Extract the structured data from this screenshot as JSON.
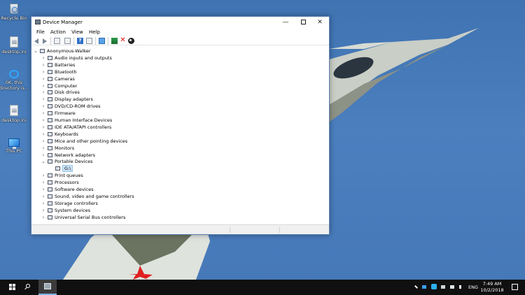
{
  "desktop": {
    "icons": [
      {
        "label": "Recycle Bin",
        "icon": "recycle-bin-icon"
      },
      {
        "label": "desktop.ini",
        "icon": "file-icon"
      },
      {
        "label": "0K, this directory is...",
        "icon": "onedrive-icon"
      },
      {
        "label": "desktop.ini",
        "icon": "file-icon"
      },
      {
        "label": "This PC",
        "icon": "this-pc-icon"
      }
    ]
  },
  "window": {
    "title": "Device Manager",
    "menu": [
      "File",
      "Action",
      "View",
      "Help"
    ],
    "controls": {
      "minimize": "—",
      "close": "✕"
    },
    "tree": {
      "root": "Anonymous-Walker",
      "categories": [
        {
          "label": "Audio inputs and outputs",
          "expanded": false
        },
        {
          "label": "Batteries",
          "expanded": false
        },
        {
          "label": "Bluetooth",
          "expanded": false
        },
        {
          "label": "Cameras",
          "expanded": false
        },
        {
          "label": "Computer",
          "expanded": false
        },
        {
          "label": "Disk drives",
          "expanded": false
        },
        {
          "label": "Display adapters",
          "expanded": false
        },
        {
          "label": "DVD/CD-ROM drives",
          "expanded": false
        },
        {
          "label": "Firmware",
          "expanded": false
        },
        {
          "label": "Human Interface Devices",
          "expanded": false
        },
        {
          "label": "IDE ATA/ATAPI controllers",
          "expanded": false
        },
        {
          "label": "Keyboards",
          "expanded": false
        },
        {
          "label": "Mice and other pointing devices",
          "expanded": false
        },
        {
          "label": "Monitors",
          "expanded": false
        },
        {
          "label": "Network adapters",
          "expanded": false
        },
        {
          "label": "Portable Devices",
          "expanded": true,
          "children": [
            "G:\\"
          ]
        },
        {
          "label": "Print queues",
          "expanded": false
        },
        {
          "label": "Processors",
          "expanded": false
        },
        {
          "label": "Software devices",
          "expanded": false
        },
        {
          "label": "Sound, video and game controllers",
          "expanded": false
        },
        {
          "label": "Storage controllers",
          "expanded": false
        },
        {
          "label": "System devices",
          "expanded": false
        },
        {
          "label": "Universal Serial Bus controllers",
          "expanded": false
        }
      ]
    }
  },
  "taskbar": {
    "language": "ENG",
    "time": "7:49 AM",
    "date": "10/2/2018"
  },
  "colors": {
    "accent": "#0078d7",
    "selection": "#cce4f7",
    "taskbar": "#101010",
    "sky": "#4678b8"
  }
}
